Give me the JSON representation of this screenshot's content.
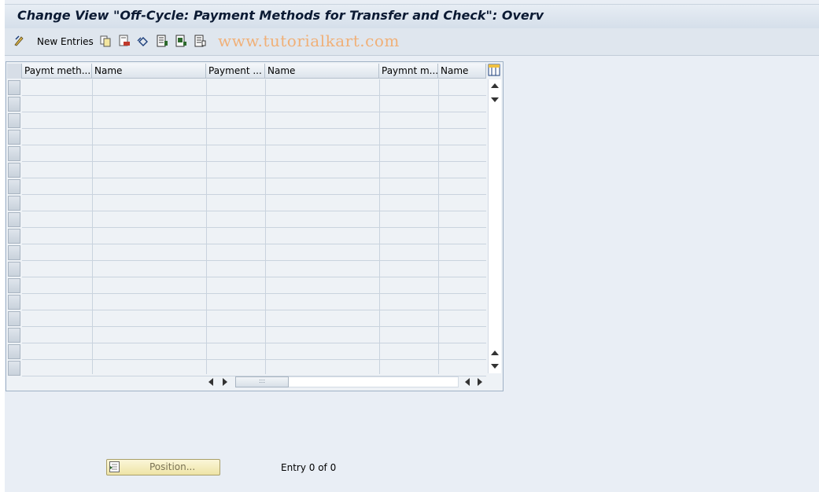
{
  "title": "Change View \"Off-Cycle: Payment Methods for Transfer and Check\": Overv",
  "toolbar": {
    "new_entries_label": "New Entries",
    "watermark": "www.tutorialkart.com",
    "icons": [
      "display-change-icon",
      "copy-icon",
      "delete-icon",
      "undo-icon",
      "select-all-icon",
      "select-block-icon",
      "deselect-all-icon"
    ]
  },
  "table": {
    "columns": [
      "Paymt meth....",
      "Name",
      "Payment ...",
      "Name",
      "Paymnt m...",
      "Name"
    ],
    "row_count": 18,
    "rows": []
  },
  "footer": {
    "position_label": "Position...",
    "entry_text": "Entry 0 of 0"
  },
  "colors": {
    "background": "#e9eef5",
    "title_text": "#0b1a33",
    "watermark": "#f0b078",
    "position_button": "#f3ebbb"
  }
}
